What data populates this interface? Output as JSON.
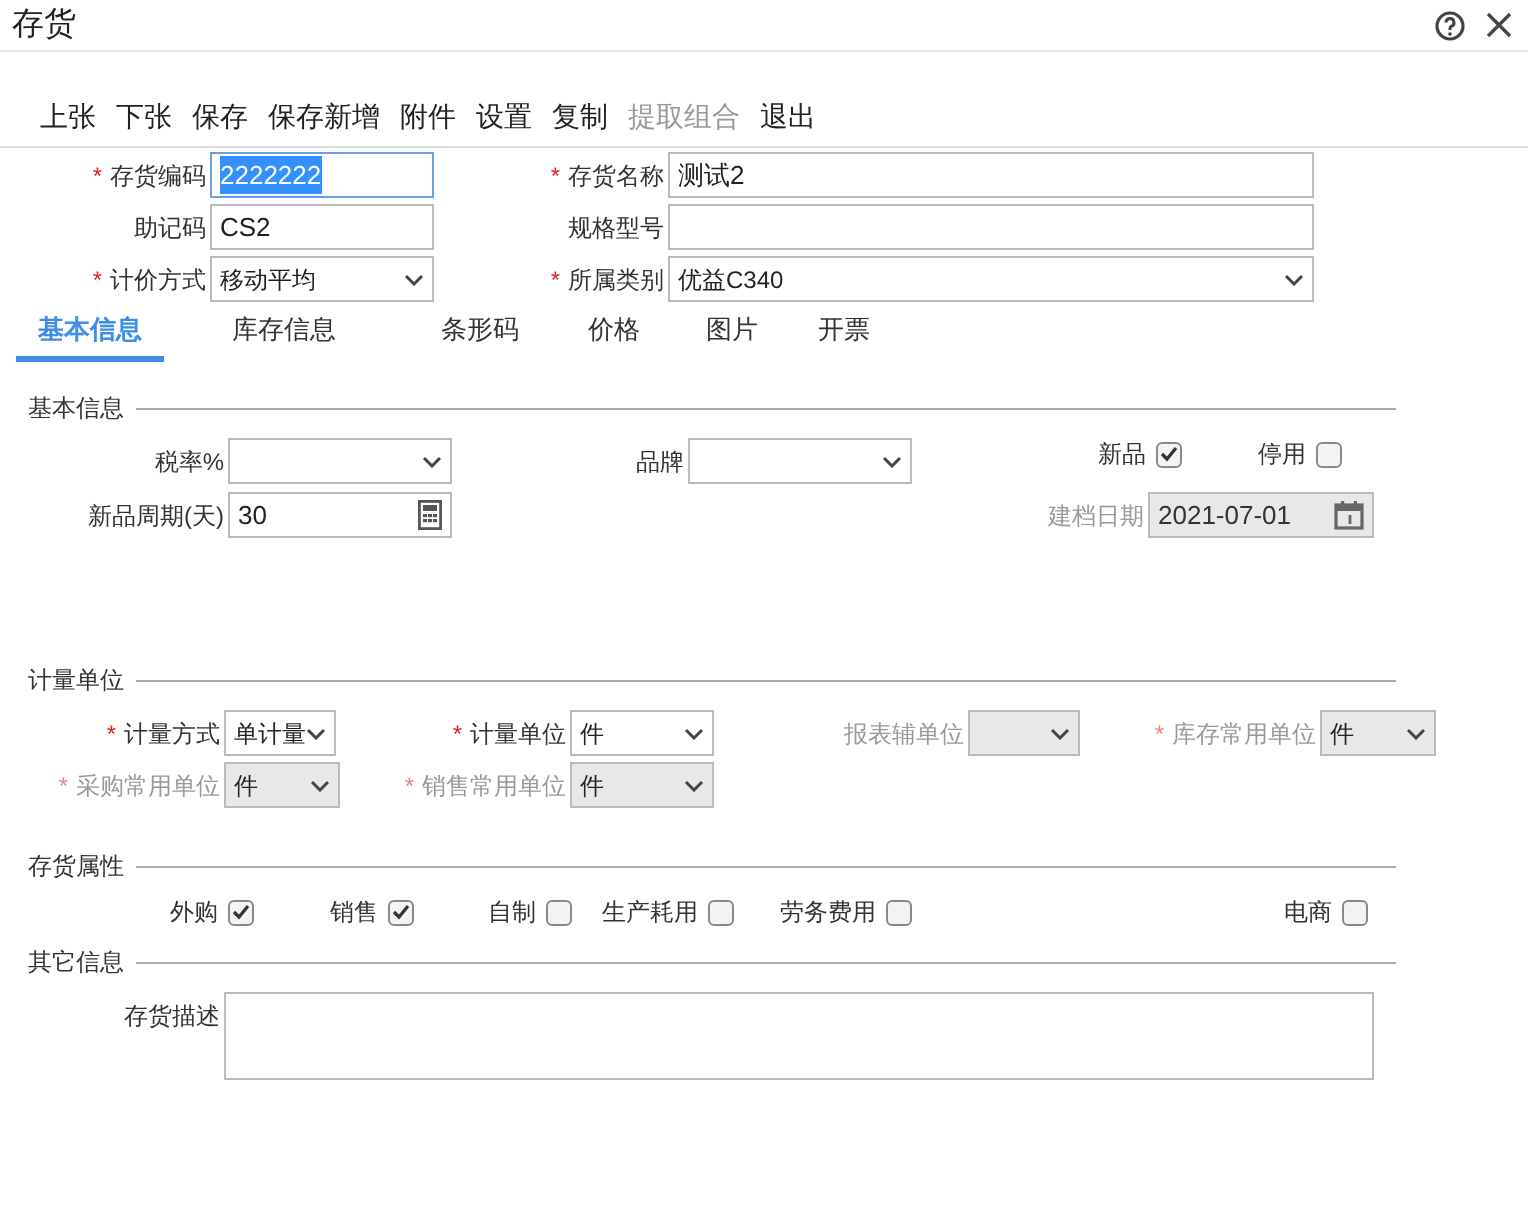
{
  "window": {
    "title": "存货"
  },
  "toolbar": [
    {
      "label": "上张",
      "disabled": false
    },
    {
      "label": "下张",
      "disabled": false
    },
    {
      "label": "保存",
      "disabled": false
    },
    {
      "label": "保存新增",
      "disabled": false
    },
    {
      "label": "附件",
      "disabled": false
    },
    {
      "label": "设置",
      "disabled": false
    },
    {
      "label": "复制",
      "disabled": false
    },
    {
      "label": "提取组合",
      "disabled": true
    },
    {
      "label": "退出",
      "disabled": false
    }
  ],
  "header_rows": [
    [
      {
        "mark": "*",
        "label": "存货编码",
        "kind": "text",
        "value": "2222222",
        "focused": true
      },
      {
        "mark": "*",
        "label": "存货名称",
        "kind": "text",
        "value": "测试2",
        "focused": false
      }
    ],
    [
      {
        "label": "助记码",
        "kind": "text",
        "value": "CS2",
        "focused": false
      },
      {
        "label": "规格型号",
        "kind": "text",
        "focused": false
      }
    ],
    [
      {
        "mark": "*",
        "label": "计价方式",
        "kind": "select",
        "value": "移动平均",
        "focused": false
      },
      {
        "mark": "*",
        "label": "所属类别",
        "kind": "select",
        "value": "优益C340",
        "focused": false
      }
    ]
  ],
  "tabs": [
    {
      "label": "基本信息",
      "selected": true
    },
    {
      "label": "库存信息",
      "selected": false
    },
    {
      "label": "条形码",
      "selected": false
    },
    {
      "label": "价格",
      "selected": false
    },
    {
      "label": "图片",
      "selected": false
    },
    {
      "label": "开票",
      "selected": false
    }
  ],
  "sections": [
    {
      "title": "基本信息",
      "rows": [
        [
          {
            "label": "税率%",
            "kind": "select",
            "disabled": false
          },
          {
            "label": "品牌",
            "kind": "select",
            "disabled": false
          },
          {
            "label": "新品",
            "kind": "checkbox",
            "checked": true
          },
          {
            "label": "停用",
            "kind": "checkbox",
            "checked": false
          }
        ],
        [
          {
            "label": "新品周期(天)",
            "kind": "number",
            "value": "30",
            "disabled": false
          },
          "",
          {
            "label": "建档日期",
            "kind": "date",
            "value": "2021-07-01",
            "disabled": true
          }
        ]
      ]
    },
    {
      "title": "计量单位",
      "rows": [
        [
          {
            "mark": "*",
            "label": "计量方式",
            "kind": "select",
            "value": "单计量",
            "disabled": false
          },
          {
            "mark": "*",
            "label": "计量单位",
            "kind": "select",
            "value": "件",
            "disabled": false
          },
          {
            "label": "报表辅单位",
            "kind": "select",
            "disabled": true
          },
          {
            "mark": "*",
            "label": "库存常用单位",
            "kind": "select",
            "value": "件",
            "disabled": true
          }
        ],
        [
          {
            "mark": "*",
            "label": "采购常用单位",
            "kind": "select",
            "value": "件",
            "disabled": true
          },
          {
            "mark": "*",
            "label": "销售常用单位",
            "kind": "select",
            "value": "件",
            "disabled": true
          }
        ]
      ]
    },
    {
      "title": "存货属性",
      "rows": [
        [
          {
            "label": "外购",
            "kind": "checkbox",
            "checked": true
          },
          {
            "label": "销售",
            "kind": "checkbox",
            "checked": true
          },
          {
            "label": "自制",
            "kind": "checkbox",
            "checked": false
          },
          {
            "label": "生产耗用",
            "kind": "checkbox",
            "checked": false
          },
          {
            "label": "劳务费用",
            "kind": "checkbox",
            "checked": false
          },
          {
            "label": "电商",
            "kind": "checkbox",
            "checked": false
          }
        ]
      ]
    },
    {
      "title": "其它信息",
      "rows": [
        [
          {
            "label": "存货描述",
            "kind": "textarea",
            "disabled": false
          }
        ]
      ]
    }
  ]
}
